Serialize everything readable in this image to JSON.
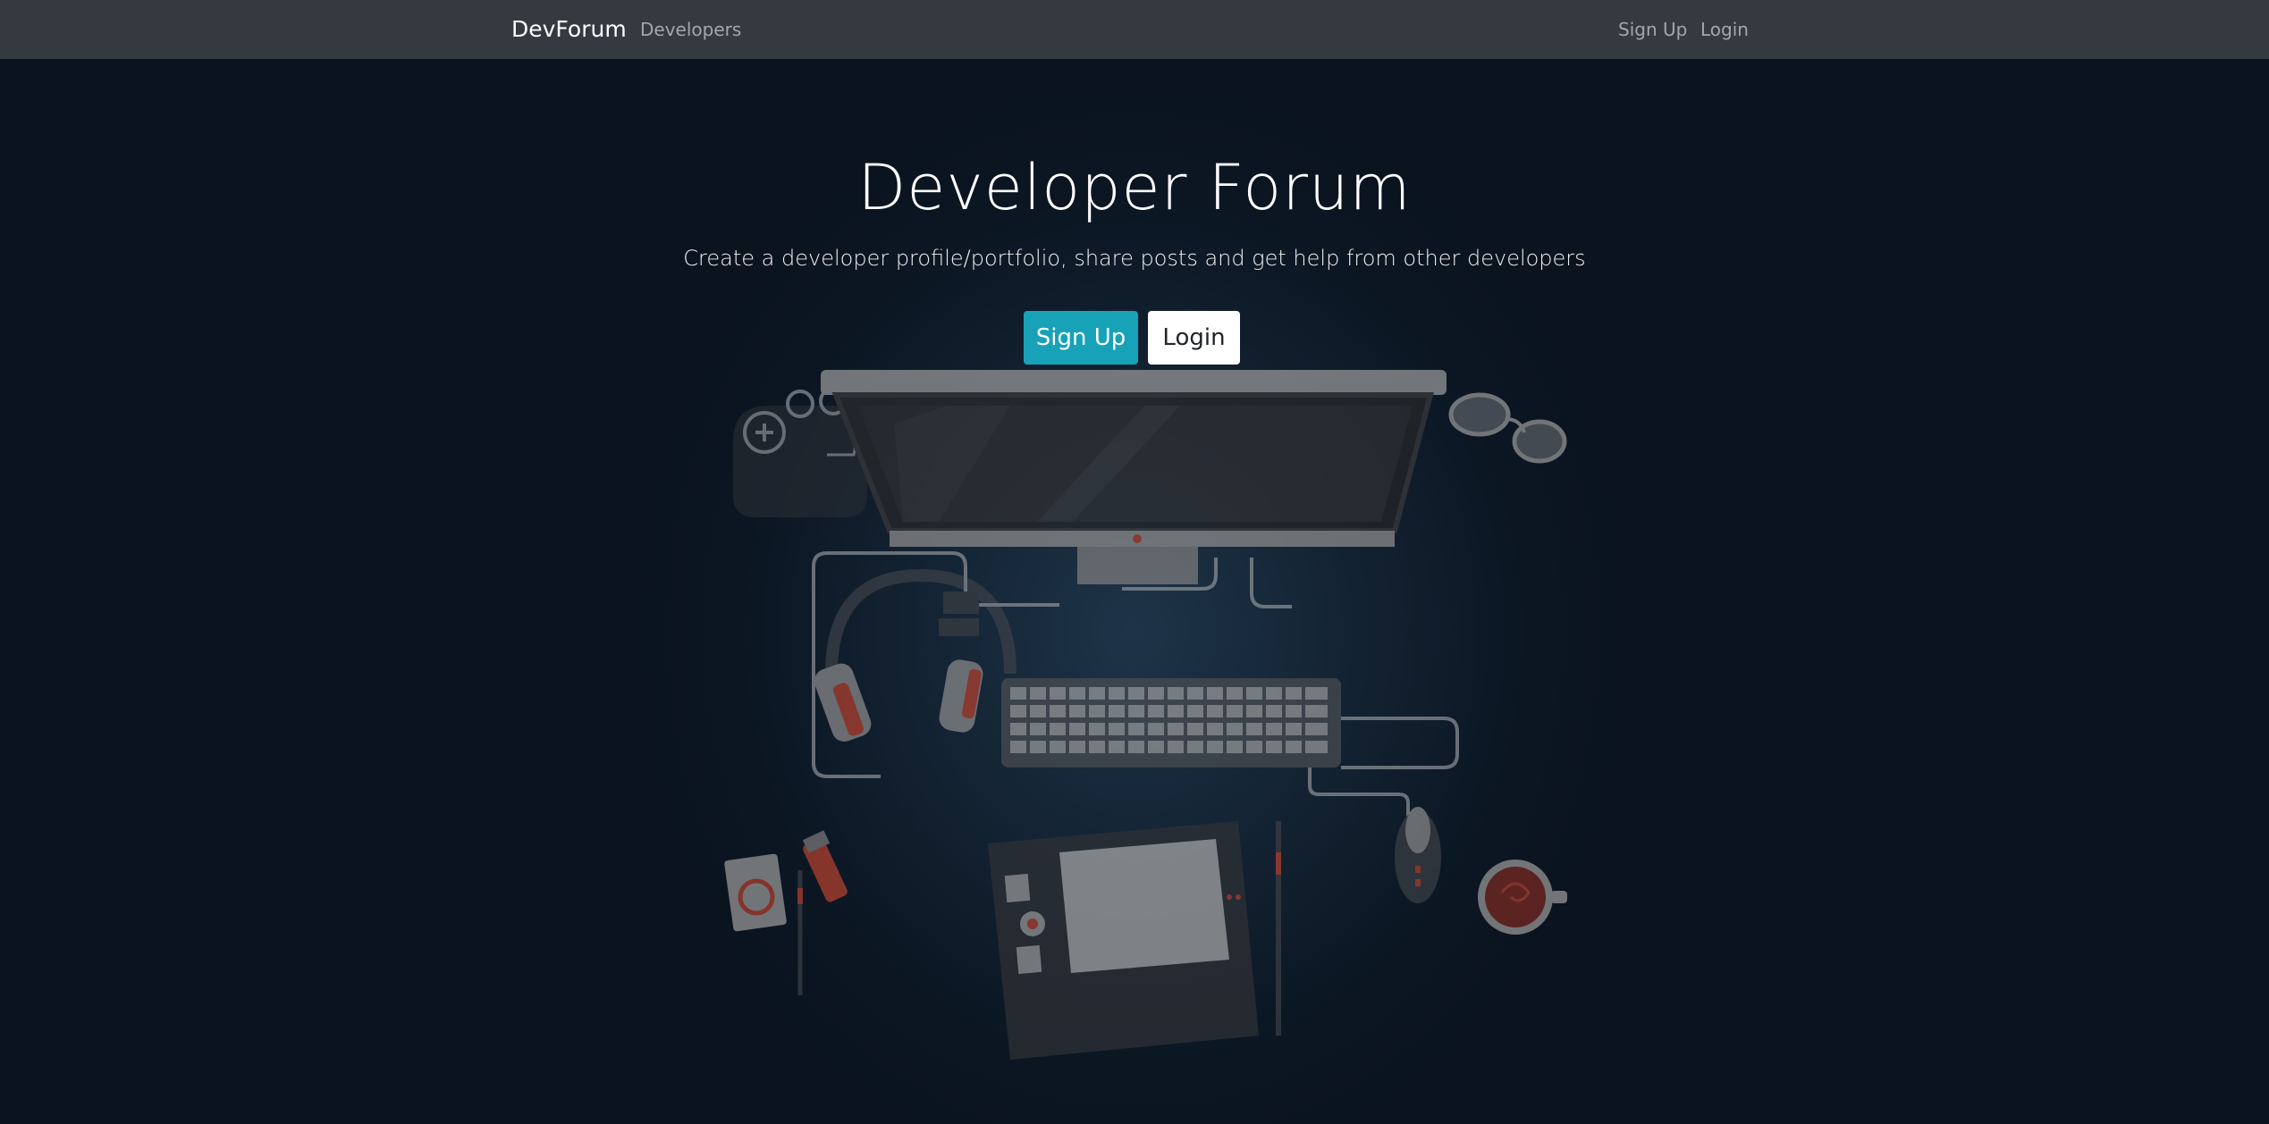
{
  "navbar": {
    "brand": "DevForum",
    "links": {
      "developers": "Developers",
      "signup": "Sign Up",
      "login": "Login"
    }
  },
  "hero": {
    "title": "Developer Forum",
    "lead": "Create a developer profile/portfolio, share posts and get help from other developers",
    "buttons": {
      "signup": "Sign Up",
      "login": "Login"
    }
  },
  "colors": {
    "navbar_bg": "#343a40",
    "primary_button": "#17a2b8",
    "hero_bg": "#0a1420",
    "accent_red": "#b5412f"
  }
}
